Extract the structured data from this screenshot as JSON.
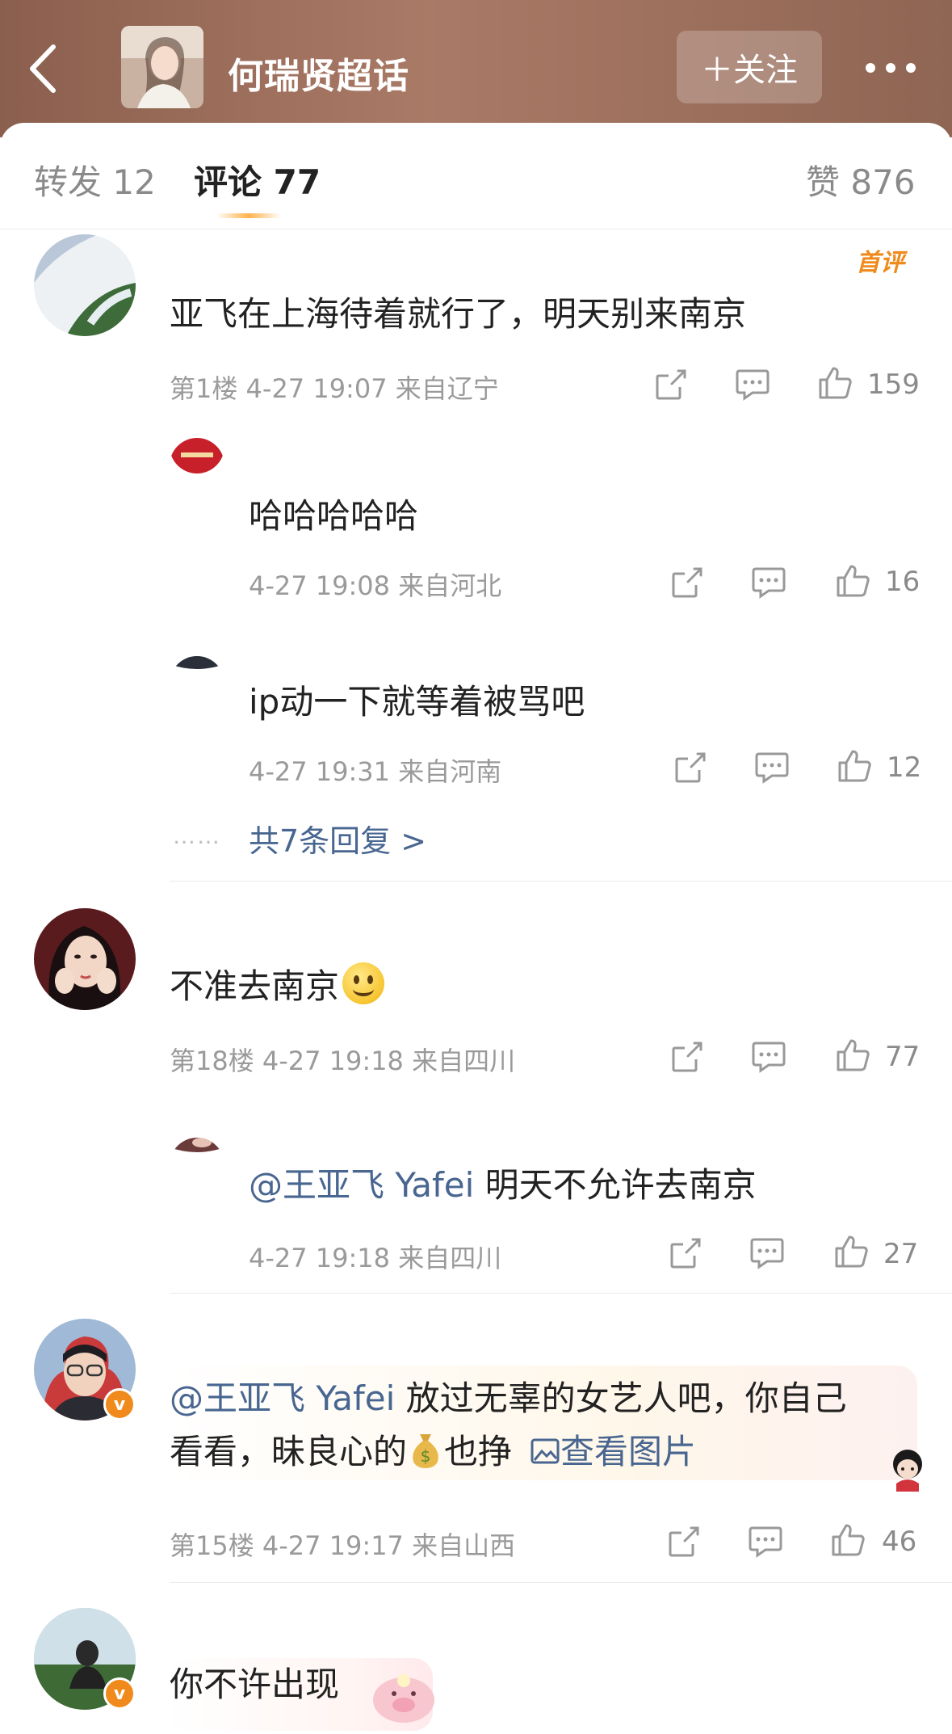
{
  "header": {
    "topic_title": "何瑞贤超话",
    "follow_label": "＋关注"
  },
  "tabs": [
    {
      "label": "转发 12"
    },
    {
      "label": "评论 77"
    },
    {
      "label": "赞 876"
    }
  ],
  "comments": [
    {
      "badge": "首评",
      "text": "亚飞在上海待着就行了，明天别来南京",
      "meta": "第1楼  4-27 19:07  来自辽宁",
      "likes": "159",
      "replies": [
        {
          "text": "哈哈哈哈哈",
          "meta": "4-27 19:08  来自河北",
          "likes": "16"
        },
        {
          "text": "ip动一下就等着被骂吧",
          "meta": "4-27 19:31  来自河南",
          "likes": "12"
        }
      ],
      "more_replies": "共7条回复 >",
      "dots": "……"
    },
    {
      "text": "不准去南京",
      "meta": "第18楼  4-27 19:18  来自四川",
      "likes": "77",
      "replies": [
        {
          "mention": "@王亚飞 Yafei",
          "text": " 明天不允许去南京",
          "meta": "4-27 19:18  来自四川",
          "likes": "27"
        }
      ]
    },
    {
      "mention": "@王亚飞 Yafei",
      "text_line1": " 放过无辜的女艺人吧，你自己",
      "text_line2a": "看看，昧良心的",
      "text_line2b": "也挣",
      "image_link": "查看图片",
      "meta": "第15楼  4-27 19:17  来自山西",
      "likes": "46",
      "verified": "v"
    },
    {
      "text": "你不许出现",
      "verified": "v"
    }
  ]
}
